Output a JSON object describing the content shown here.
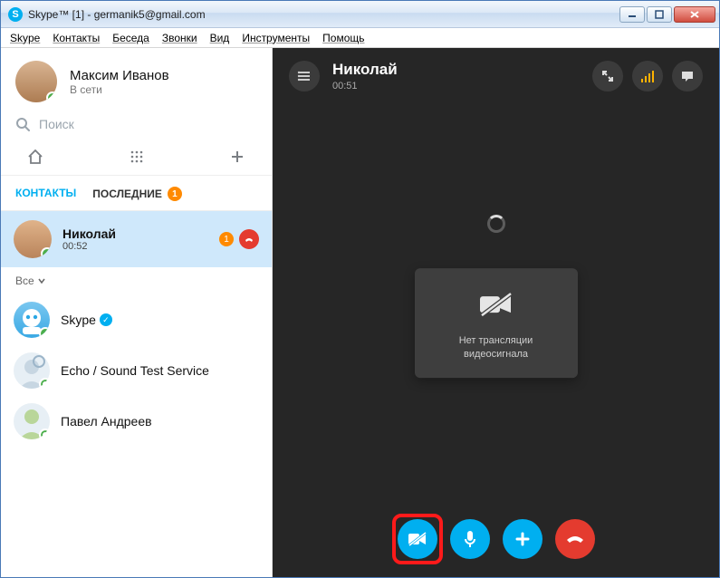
{
  "window": {
    "title": "Skype™ [1] - germanik5@gmail.com"
  },
  "menu": {
    "items": [
      "Skype",
      "Контакты",
      "Беседа",
      "Звонки",
      "Вид",
      "Инструменты",
      "Помощь"
    ]
  },
  "profile": {
    "name": "Максим Иванов",
    "status": "В сети"
  },
  "search": {
    "placeholder": "Поиск"
  },
  "section_tabs": {
    "contacts": "КОНТАКТЫ",
    "recent": "ПОСЛЕДНИЕ",
    "recent_badge": "1"
  },
  "active_contact": {
    "name": "Николай",
    "time": "00:52",
    "badge": "1"
  },
  "filter": {
    "label": "Все"
  },
  "contacts": [
    {
      "name": "Skype",
      "verified": true
    },
    {
      "name": "Echo / Sound Test Service"
    },
    {
      "name": "Павел Андреев"
    }
  ],
  "call": {
    "peer_name": "Николай",
    "duration": "00:51",
    "video_off_line1": "Нет трансляции",
    "video_off_line2": "видеосигнала"
  }
}
